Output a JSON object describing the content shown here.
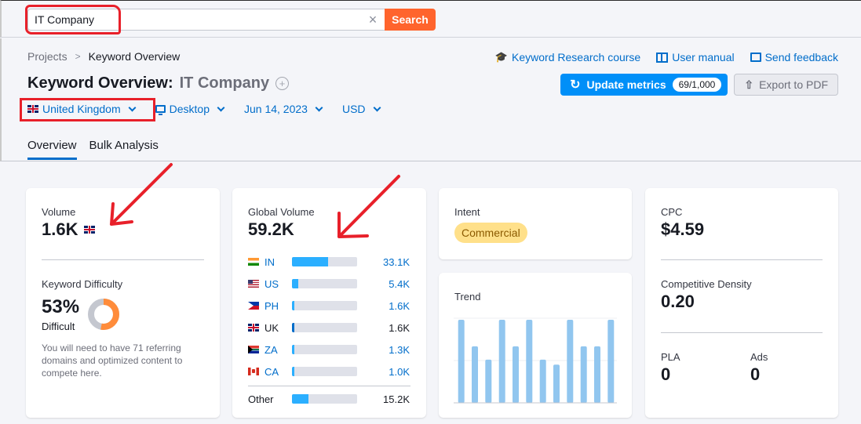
{
  "search": {
    "value": "IT Company",
    "clear_label": "×",
    "button_label": "Search"
  },
  "breadcrumb": {
    "items": [
      "Projects",
      "Keyword Overview"
    ],
    "separator": ">"
  },
  "header": {
    "title_prefix": "Keyword Overview:",
    "keyword": "IT Company",
    "add_icon": "⊕"
  },
  "filters": {
    "country": "United Kingdom",
    "device": "Desktop",
    "date": "Jun 14, 2023",
    "currency": "USD"
  },
  "top_links": {
    "course": "Keyword Research course",
    "manual": "User manual",
    "feedback": "Send feedback"
  },
  "actions": {
    "update_label": "Update metrics",
    "update_badge": "69/1,000",
    "export_label": "Export to PDF"
  },
  "tabs": [
    {
      "label": "Overview",
      "active": true
    },
    {
      "label": "Bulk Analysis",
      "active": false
    }
  ],
  "volume": {
    "label": "Volume",
    "value": "1.6K"
  },
  "keyword_difficulty": {
    "label": "Keyword Difficulty",
    "value": "53%",
    "percent": 53,
    "level": "Difficult",
    "description": "You will need to have 71 referring domains and optimized content to compete here.",
    "colors": {
      "fill": "#ff8c3b",
      "track": "#c4c7cf"
    }
  },
  "global_volume": {
    "label": "Global Volume",
    "value": "59.2K",
    "countries": [
      {
        "code": "IN",
        "value": "33.1K",
        "share": 0.559,
        "flag": "in",
        "link": true
      },
      {
        "code": "US",
        "value": "5.4K",
        "share": 0.091,
        "flag": "us",
        "link": true
      },
      {
        "code": "PH",
        "value": "1.6K",
        "share": 0.027,
        "flag": "ph",
        "link": true
      },
      {
        "code": "UK",
        "value": "1.6K",
        "share": 0.027,
        "flag": "uk",
        "link": false
      },
      {
        "code": "ZA",
        "value": "1.3K",
        "share": 0.022,
        "flag": "za",
        "link": true
      },
      {
        "code": "CA",
        "value": "1.0K",
        "share": 0.017,
        "flag": "ca",
        "link": true
      }
    ],
    "other": {
      "label": "Other",
      "value": "15.2K",
      "share": 0.257
    }
  },
  "intent": {
    "label": "Intent",
    "badge": "Commercial"
  },
  "trend": {
    "label": "Trend",
    "values": [
      1.0,
      0.68,
      0.52,
      1.0,
      0.68,
      1.0,
      0.52,
      0.46,
      1.0,
      0.68,
      0.68,
      1.0
    ],
    "bar_color": "#91c6ef"
  },
  "cpc": {
    "label": "CPC",
    "value": "$4.59"
  },
  "competitive_density": {
    "label": "Competitive Density",
    "value": "0.20"
  },
  "pla": {
    "label": "PLA",
    "value": "0"
  },
  "ads": {
    "label": "Ads",
    "value": "0"
  },
  "colors": {
    "accent": "#006dca",
    "search_button": "#ff642d",
    "update_button": "#008ff8",
    "annotation": "#e8202a",
    "bar_fill": "#2bafff",
    "uk_bar_fill": "#006dca"
  }
}
